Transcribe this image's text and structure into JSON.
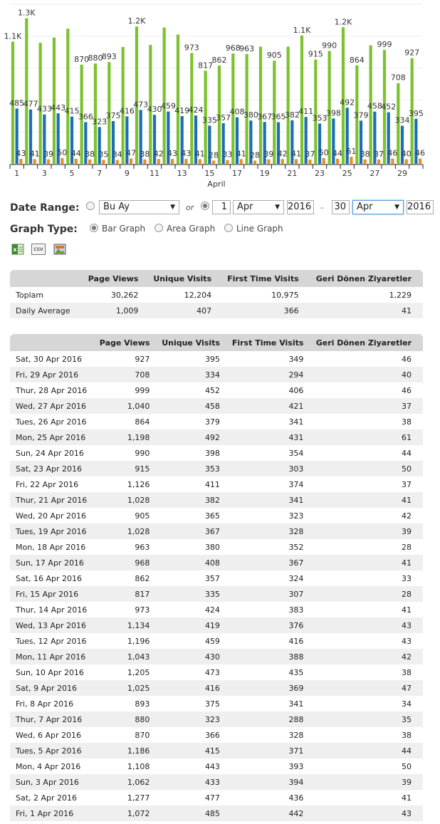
{
  "chart_data": {
    "type": "bar",
    "xlabel": "April",
    "categories": [
      "1",
      "2",
      "3",
      "4",
      "5",
      "6",
      "7",
      "8",
      "9",
      "10",
      "11",
      "12",
      "13",
      "14",
      "15",
      "16",
      "17",
      "18",
      "19",
      "20",
      "21",
      "22",
      "23",
      "24",
      "25",
      "26",
      "27",
      "28",
      "29",
      "30"
    ],
    "x_tick_labels": [
      "1",
      "3",
      "5",
      "7",
      "9",
      "11",
      "13",
      "15",
      "17",
      "19",
      "21",
      "23",
      "25",
      "27",
      "29"
    ],
    "ylim": [
      0,
      1400
    ],
    "series": [
      {
        "name": "Page Views",
        "color": "#7cc22c",
        "values": [
          1072,
          1277,
          1062,
          1108,
          1186,
          870,
          880,
          893,
          1025,
          1205,
          1043,
          1196,
          1134,
          973,
          817,
          862,
          968,
          963,
          1028,
          905,
          1028,
          1126,
          915,
          990,
          1198,
          864,
          1040,
          999,
          708,
          927
        ],
        "labels": [
          "1.1K",
          "1.3K",
          "",
          "",
          "",
          "870",
          "880",
          "893",
          "",
          "1.2K",
          "",
          "",
          "",
          "973",
          "817",
          "862",
          "968",
          "963",
          "",
          "905",
          "",
          "1.1K",
          "915",
          "990",
          "1.2K",
          "864",
          "",
          "999",
          "708",
          "927"
        ]
      },
      {
        "name": "Unique Visits",
        "color": "#1a6fb5",
        "values": [
          485,
          477,
          433,
          443,
          415,
          366,
          323,
          375,
          416,
          473,
          430,
          459,
          419,
          424,
          335,
          357,
          408,
          380,
          367,
          365,
          382,
          411,
          353,
          398,
          492,
          379,
          458,
          452,
          334,
          395
        ],
        "labels": [
          "485",
          "477",
          "433",
          "443",
          "415",
          "366",
          "323",
          "375",
          "416",
          "473",
          "430",
          "459",
          "419",
          "424",
          "335",
          "357",
          "408",
          "380",
          "367",
          "365",
          "382",
          "411",
          "353",
          "398",
          "492",
          "379",
          "458",
          "452",
          "334",
          "395"
        ]
      },
      {
        "name": "Geri Dönen Ziyaretler",
        "color": "#f08b1d",
        "values": [
          43,
          41,
          39,
          50,
          44,
          38,
          35,
          34,
          47,
          38,
          42,
          43,
          43,
          41,
          28,
          33,
          41,
          28,
          39,
          42,
          41,
          37,
          50,
          44,
          61,
          38,
          37,
          46,
          40,
          46
        ],
        "labels": [
          "43",
          "41",
          "39",
          "50",
          "44",
          "38",
          "35",
          "34",
          "47",
          "38",
          "42",
          "43",
          "43",
          "41",
          "28",
          "33",
          "41",
          "28",
          "39",
          "42",
          "41",
          "37",
          "50",
          "44",
          "61",
          "38",
          "37",
          "46",
          "40",
          "46"
        ]
      }
    ]
  },
  "controls": {
    "date_range_label": "Date Range:",
    "period_select": "Bu Ay",
    "or_text": "or",
    "start_day": "1",
    "start_month": "Apr",
    "start_year": "2016",
    "dash": "-",
    "end_day": "30",
    "end_month": "Apr",
    "end_year": "2016",
    "graph_type_label": "Graph Type:",
    "bar_graph": "Bar Graph",
    "area_graph": "Area Graph",
    "line_graph": "Line Graph"
  },
  "export": {
    "excel_icon": "excel-export-icon",
    "csv_icon": "csv-export-icon",
    "image_icon": "image-export-icon",
    "csv_text": "csv"
  },
  "summary": {
    "headers": [
      "",
      "Page Views",
      "Unique Visits",
      "First Time Visits",
      "Geri Dönen Ziyaretler"
    ],
    "rows": [
      [
        "Toplam",
        "30,262",
        "12,204",
        "10,975",
        "1,229"
      ],
      [
        "Daily Average",
        "1,009",
        "407",
        "366",
        "41"
      ]
    ]
  },
  "daily": {
    "headers": [
      "",
      "Page Views",
      "Unique Visits",
      "First Time Visits",
      "Geri Dönen Ziyaretler"
    ],
    "rows": [
      [
        "Sat, 30 Apr 2016",
        "927",
        "395",
        "349",
        "46"
      ],
      [
        "Fri, 29 Apr 2016",
        "708",
        "334",
        "294",
        "40"
      ],
      [
        "Thur, 28 Apr 2016",
        "999",
        "452",
        "406",
        "46"
      ],
      [
        "Wed, 27 Apr 2016",
        "1,040",
        "458",
        "421",
        "37"
      ],
      [
        "Tues, 26 Apr 2016",
        "864",
        "379",
        "341",
        "38"
      ],
      [
        "Mon, 25 Apr 2016",
        "1,198",
        "492",
        "431",
        "61"
      ],
      [
        "Sun, 24 Apr 2016",
        "990",
        "398",
        "354",
        "44"
      ],
      [
        "Sat, 23 Apr 2016",
        "915",
        "353",
        "303",
        "50"
      ],
      [
        "Fri, 22 Apr 2016",
        "1,126",
        "411",
        "374",
        "37"
      ],
      [
        "Thur, 21 Apr 2016",
        "1,028",
        "382",
        "341",
        "41"
      ],
      [
        "Wed, 20 Apr 2016",
        "905",
        "365",
        "323",
        "42"
      ],
      [
        "Tues, 19 Apr 2016",
        "1,028",
        "367",
        "328",
        "39"
      ],
      [
        "Mon, 18 Apr 2016",
        "963",
        "380",
        "352",
        "28"
      ],
      [
        "Sun, 17 Apr 2016",
        "968",
        "408",
        "367",
        "41"
      ],
      [
        "Sat, 16 Apr 2016",
        "862",
        "357",
        "324",
        "33"
      ],
      [
        "Fri, 15 Apr 2016",
        "817",
        "335",
        "307",
        "28"
      ],
      [
        "Thur, 14 Apr 2016",
        "973",
        "424",
        "383",
        "41"
      ],
      [
        "Wed, 13 Apr 2016",
        "1,134",
        "419",
        "376",
        "43"
      ],
      [
        "Tues, 12 Apr 2016",
        "1,196",
        "459",
        "416",
        "43"
      ],
      [
        "Mon, 11 Apr 2016",
        "1,043",
        "430",
        "388",
        "42"
      ],
      [
        "Sun, 10 Apr 2016",
        "1,205",
        "473",
        "435",
        "38"
      ],
      [
        "Sat, 9 Apr 2016",
        "1,025",
        "416",
        "369",
        "47"
      ],
      [
        "Fri, 8 Apr 2016",
        "893",
        "375",
        "341",
        "34"
      ],
      [
        "Thur, 7 Apr 2016",
        "880",
        "323",
        "288",
        "35"
      ],
      [
        "Wed, 6 Apr 2016",
        "870",
        "366",
        "328",
        "38"
      ],
      [
        "Tues, 5 Apr 2016",
        "1,186",
        "415",
        "371",
        "44"
      ],
      [
        "Mon, 4 Apr 2016",
        "1,108",
        "443",
        "393",
        "50"
      ],
      [
        "Sun, 3 Apr 2016",
        "1,062",
        "433",
        "394",
        "39"
      ],
      [
        "Sat, 2 Apr 2016",
        "1,277",
        "477",
        "436",
        "41"
      ],
      [
        "Fri, 1 Apr 2016",
        "1,072",
        "485",
        "442",
        "43"
      ]
    ]
  }
}
